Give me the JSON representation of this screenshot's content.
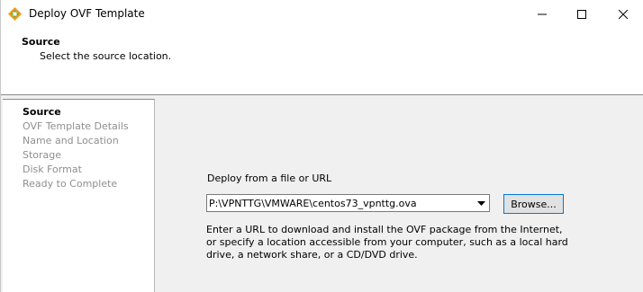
{
  "window": {
    "title": "Deploy OVF Template",
    "app_icon": "ovf-wizard-app-icon",
    "controls": [
      "minimize-icon",
      "maximize-icon",
      "close-icon"
    ]
  },
  "header": {
    "title": "Source",
    "subtitle": "Select the source location."
  },
  "steps": [
    {
      "label": "Source",
      "current": true
    },
    {
      "label": "OVF Template Details",
      "current": false
    },
    {
      "label": "Name and Location",
      "current": false
    },
    {
      "label": "Storage",
      "current": false
    },
    {
      "label": "Disk Format",
      "current": false
    },
    {
      "label": "Ready to Complete",
      "current": false
    }
  ],
  "form": {
    "field_label": "Deploy from a file or URL",
    "path_value": "P:\\VPNTTG\\VMWARE\\centos73_vpnttg.ova",
    "browse_label": "Browse...",
    "help_text": "Enter a URL to download and install the OVF package from the Internet, or specify a location accessible from your computer, such as a local hard drive, a network share, or a CD/DVD drive."
  },
  "colors": {
    "accent": "#0078d7",
    "disabled_step": "#8f8f8f",
    "panel_bg": "#f0f0f0"
  }
}
